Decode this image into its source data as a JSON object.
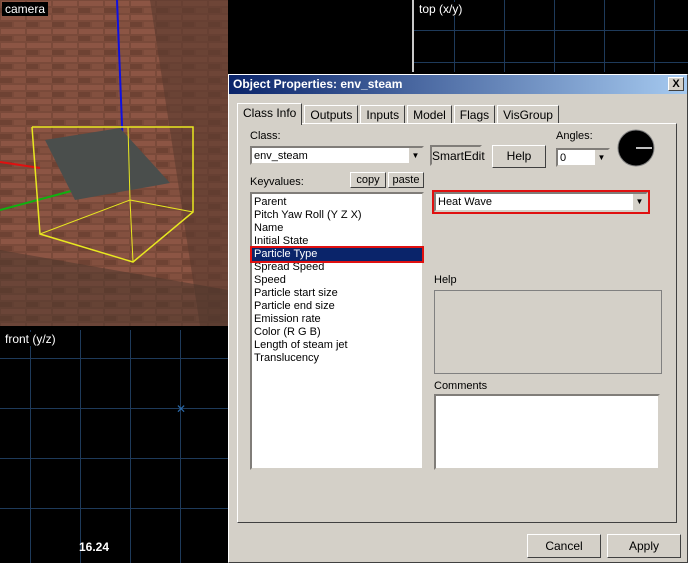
{
  "viewports": {
    "camera_label": "camera",
    "top_label": "top (x/y)",
    "front_label": "front (y/z)",
    "front_readout": "16.24"
  },
  "dialog": {
    "title": "Object Properties: env_steam",
    "close": "X",
    "tabs": [
      "Class Info",
      "Outputs",
      "Inputs",
      "Model",
      "Flags",
      "VisGroup"
    ],
    "class_label": "Class:",
    "class_value": "env_steam",
    "smartedit_label": "SmartEdit",
    "help_button": "Help",
    "angles_label": "Angles:",
    "angles_value": "0",
    "keyvalues_label": "Keyvalues:",
    "copy_label": "copy",
    "paste_label": "paste",
    "keyvalues": [
      "Parent",
      "Pitch Yaw Roll (Y Z X)",
      "Name",
      "Initial State",
      "Particle Type",
      "Spread Speed",
      "Speed",
      "Particle start size",
      "Particle end size",
      "Emission rate",
      "Color (R G B)",
      "Length of steam jet",
      "Translucency"
    ],
    "selected_key": "Particle Type",
    "value_select": "Heat Wave",
    "help_section_label": "Help",
    "comments_label": "Comments",
    "cancel_label": "Cancel",
    "apply_label": "Apply"
  }
}
